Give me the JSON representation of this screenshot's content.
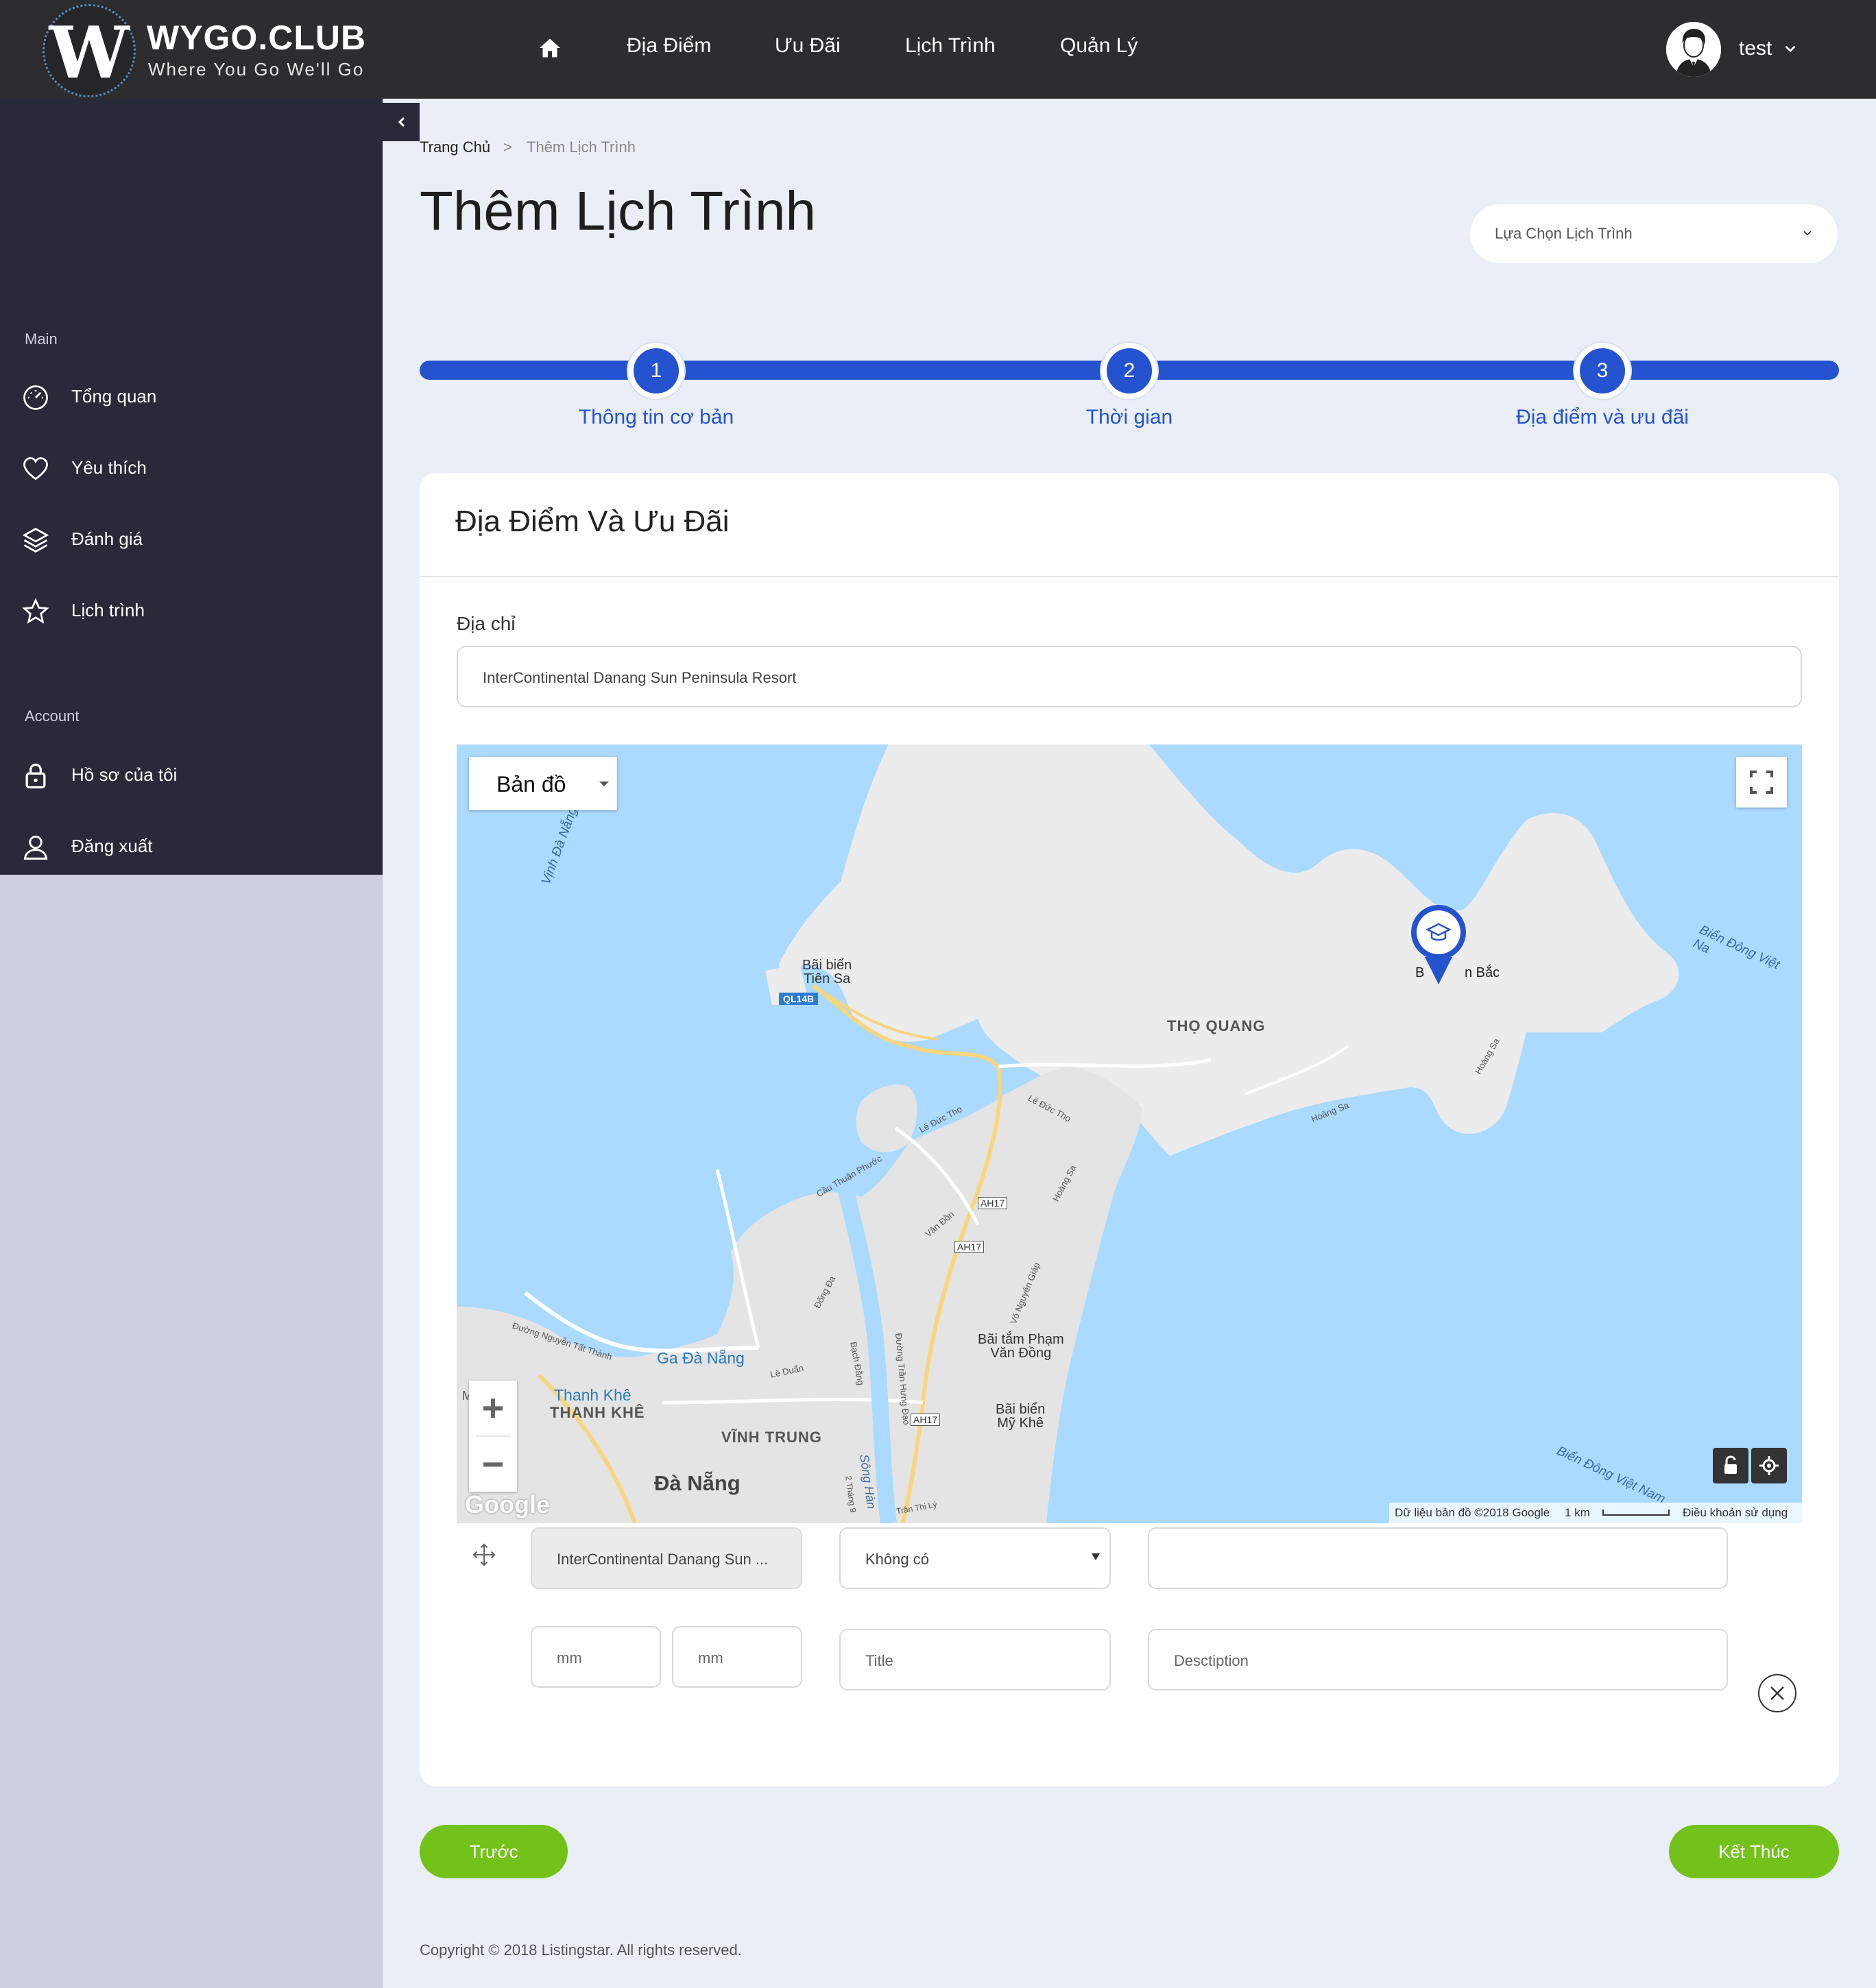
{
  "brand": {
    "name": "WYGO.CLUB",
    "tagline": "Where You Go We'll Go",
    "logo_letter": "W"
  },
  "nav": {
    "items": [
      {
        "label": "Địa Điểm"
      },
      {
        "label": "Ưu Đãi"
      },
      {
        "label": "Lịch Trình"
      },
      {
        "label": "Quản Lý"
      }
    ]
  },
  "user": {
    "name": "test"
  },
  "sidebar": {
    "section_main": "Main",
    "section_account": "Account",
    "main_items": [
      {
        "label": "Tổng quan",
        "icon": "dashboard-icon"
      },
      {
        "label": "Yêu thích",
        "icon": "heart-icon"
      },
      {
        "label": "Đánh giá",
        "icon": "layers-icon"
      },
      {
        "label": "Lịch trình",
        "icon": "star-icon"
      }
    ],
    "account_items": [
      {
        "label": "Hồ sơ của tôi",
        "icon": "lock-icon"
      },
      {
        "label": "Đăng xuất",
        "icon": "user-icon"
      }
    ]
  },
  "breadcrumb": {
    "home": "Trang Chủ",
    "separator": ">",
    "current": "Thêm Lịch Trình"
  },
  "page": {
    "title": "Thêm Lịch Trình"
  },
  "route_select": {
    "placeholder": "Lựa Chọn Lịch Trình"
  },
  "stepper": {
    "steps": [
      {
        "number": "1",
        "label": "Thông tin cơ bản"
      },
      {
        "number": "2",
        "label": "Thời gian"
      },
      {
        "number": "3",
        "label": "Địa điểm và ưu đãi"
      }
    ]
  },
  "card": {
    "title": "Địa Điểm Và Ưu Đãi",
    "address_label": "Địa chỉ",
    "address_value": "InterContinental Danang Sun Peninsula Resort"
  },
  "map": {
    "type_label": "Bản đồ",
    "zoom_in": "+",
    "zoom_out": "−",
    "google": "Google",
    "footer_data": "Dữ liệu bản đồ ©2018 Google",
    "footer_scale": "1 km",
    "footer_terms": "Điều khoản sử dụng",
    "labels": {
      "bai_bien_tien_sa_1": "Bãi biển",
      "bai_bien_tien_sa_2": "Tiên Sa",
      "ql14b": "QL14B",
      "tho_quang": "THỌ QUANG",
      "marker_label_1": "B",
      "marker_label_2": "n Bắc",
      "bien_dong_1": "Biển Đông Việt Na",
      "bien_dong_2": "Biển Đông Việt Nam",
      "vinh_da_nang": "Vịnh Đà Nẵng",
      "le_duc_tho_1": "Lê Đức Thọ",
      "le_duc_tho_2": "Lê Đức Thọ",
      "hoang_sa_1": "Hoàng Sa",
      "hoang_sa_2": "Hoàng Sa",
      "hoang_sa_3": "Hoàng Sa",
      "cau_thuan_phuoc": "Cầu Thuận Phước",
      "ah17_1": "AH17",
      "ah17_2": "AH17",
      "ah17_3": "AH17",
      "van_don": "Vân Đồn",
      "vo_nguyen_giap": "Võ Nguyên Giáp",
      "dong_da": "Đống Đa",
      "bai_tam_1": "Bãi tắm Phạm",
      "bai_tam_2": "Văn Đồng",
      "bai_bien_my_khe_1": "Bãi biển",
      "bai_bien_my_khe_2": "Mỹ Khê",
      "nguyen_tat_thanh": "Đường Nguyễn Tất Thành",
      "ga_da_nang": "Ga Đà Nẵng",
      "le_duan": "Lê Duẩn",
      "bach_dang": "Bạch Đằng",
      "tran_hung_dao": "Đường Trần Hưng Đạo",
      "thanh_khe_station": "Thanh Khê",
      "thanh_khe": "THANH KHÊ",
      "vinh_trung": "VĨNH TRUNG",
      "da_nang": "Đà Nẵng",
      "song_han": "Sông Hàn",
      "hai_thang_chin": "2 Tháng 9",
      "tran_thi_ly": "Trần Thị Lý",
      "edge_letters": "M"
    }
  },
  "row": {
    "location_value": "InterContinental Danang Sun ...",
    "offer_select": "Không có",
    "extra_value": "",
    "time_start_placeholder": "mm",
    "time_end_placeholder": "mm",
    "title_placeholder": "Title",
    "description_placeholder": "Desctiption"
  },
  "buttons": {
    "prev": "Trước",
    "finish": "Kết Thúc"
  },
  "footer": {
    "copyright": "Copyright © 2018 Listingstar. All rights reserved."
  },
  "colors": {
    "topbar": "#2d2d2f",
    "sidebar": "#282a3a",
    "accent_blue": "#2553d0",
    "accent_green": "#73c21a",
    "page_bg": "#e9eef7",
    "water": "#aadaff",
    "land": "#ececec"
  }
}
